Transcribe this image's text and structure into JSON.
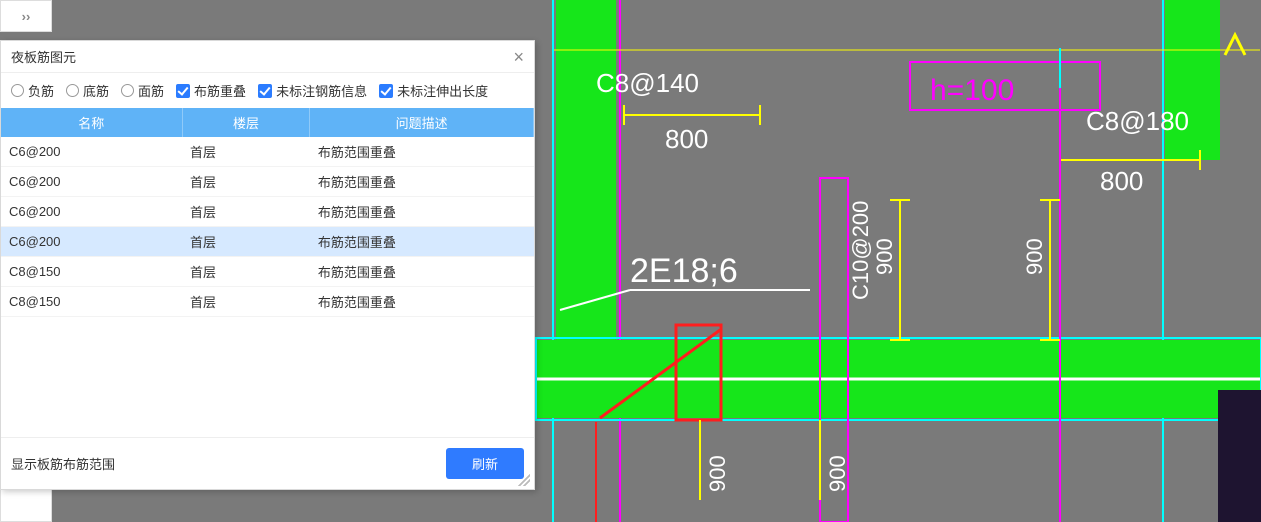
{
  "toolbar": {
    "collapse_glyph": "››"
  },
  "panel": {
    "title": "夜板筋图元",
    "close_glyph": "×",
    "radios": {
      "r1": "负筋",
      "r2": "底筋",
      "r3": "面筋"
    },
    "checks": {
      "c1": "布筋重叠",
      "c2": "未标注钢筋信息",
      "c3": "未标注伸出长度"
    },
    "columns": {
      "name": "名称",
      "floor": "楼层",
      "issue": "问题描述"
    },
    "rows": [
      {
        "name": "C6@200",
        "floor": "首层",
        "issue": "布筋范围重叠",
        "sel": false
      },
      {
        "name": "C6@200",
        "floor": "首层",
        "issue": "布筋范围重叠",
        "sel": false
      },
      {
        "name": "C6@200",
        "floor": "首层",
        "issue": "布筋范围重叠",
        "sel": false
      },
      {
        "name": "C6@200",
        "floor": "首层",
        "issue": "布筋范围重叠",
        "sel": true
      },
      {
        "name": "C8@150",
        "floor": "首层",
        "issue": "布筋范围重叠",
        "sel": false
      },
      {
        "name": "C8@150",
        "floor": "首层",
        "issue": "布筋范围重叠",
        "sel": false
      }
    ],
    "footer_label": "显示板筋布筋范围",
    "refresh": "刷新"
  },
  "drawing": {
    "labels": {
      "c8_140": "C8@140",
      "c8_180": "C8@180",
      "c10_200": "C10@200",
      "h100": "h=100",
      "beam": "2E18;6"
    },
    "dims": {
      "d800a": "800",
      "d800b": "800",
      "d900a": "900",
      "d900b": "900",
      "d900c": "900",
      "d900d": "900"
    },
    "colors": {
      "bg": "#7a7a7a",
      "green": "#16e61a",
      "magenta": "#ff00ff",
      "cyan": "#00ffff",
      "yellow": "#ffff00",
      "red": "#ff1e1e",
      "white": "#ffffff",
      "dark": "#1e1430"
    }
  }
}
